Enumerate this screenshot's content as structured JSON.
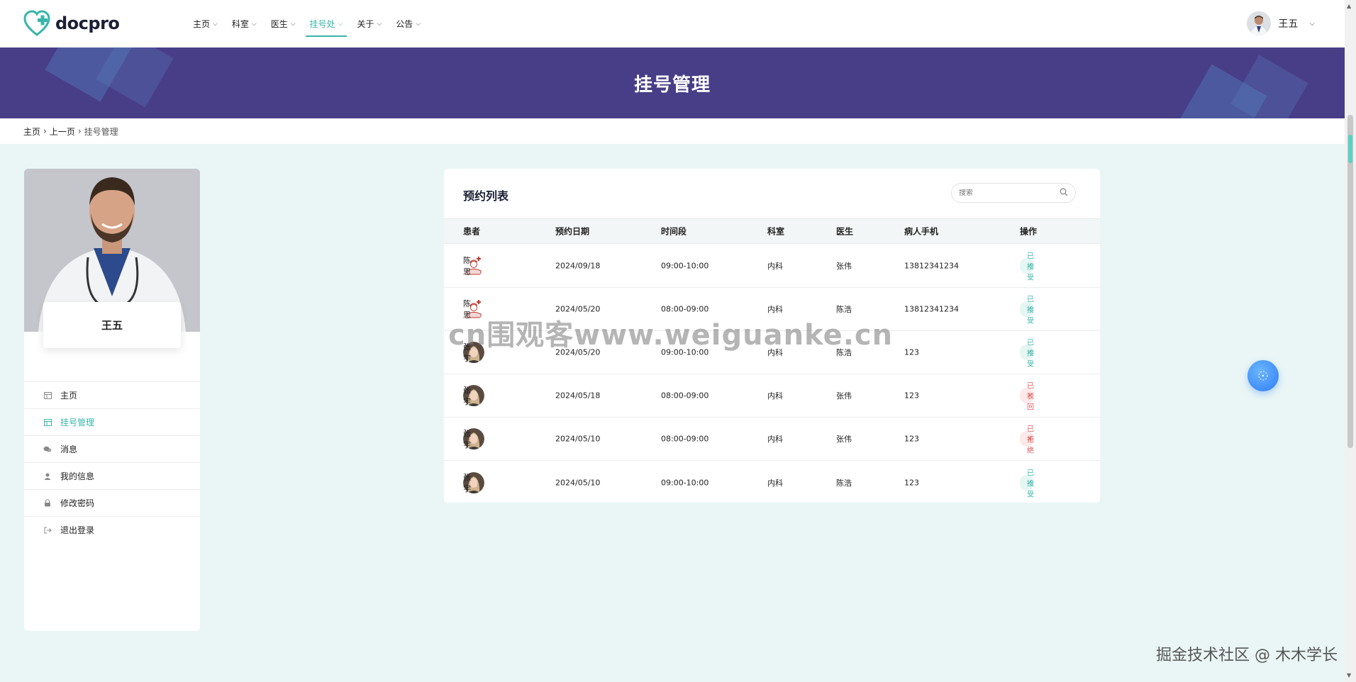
{
  "brand": {
    "name": "docpro",
    "accent": "#3ab5a9",
    "banner_color": "#483e87"
  },
  "nav": {
    "items": [
      {
        "label": "主页",
        "active": false
      },
      {
        "label": "科室",
        "active": false
      },
      {
        "label": "医生",
        "active": false
      },
      {
        "label": "挂号处",
        "active": true
      },
      {
        "label": "关于",
        "active": false
      },
      {
        "label": "公告",
        "active": false
      }
    ]
  },
  "user": {
    "name": "王五"
  },
  "banner": {
    "title": "挂号管理"
  },
  "breadcrumb": {
    "home": "主页",
    "prev": "上一页",
    "current": "挂号管理"
  },
  "sidebar": {
    "profile_name": "王五",
    "menu": [
      {
        "label": "主页",
        "icon": "layout-icon",
        "active": false
      },
      {
        "label": "挂号管理",
        "icon": "layout-icon",
        "active": true
      },
      {
        "label": "消息",
        "icon": "chat-icon",
        "active": false
      },
      {
        "label": "我的信息",
        "icon": "user-icon",
        "active": false
      },
      {
        "label": "修改密码",
        "icon": "lock-icon",
        "active": false
      },
      {
        "label": "退出登录",
        "icon": "logout-icon",
        "active": false
      }
    ]
  },
  "appointments": {
    "title": "预约列表",
    "search_placeholder": "搜索",
    "columns": [
      "患者",
      "预约日期",
      "时间段",
      "科室",
      "医生",
      "病人手机",
      "操作"
    ],
    "rows": [
      {
        "patient": "陈思",
        "avatar": "nurse",
        "date": "2024/09/18",
        "slot": "09:00-10:00",
        "dept": "内科",
        "doctor": "张伟",
        "phone": "13812341234",
        "status": "已接受",
        "status_type": "ok"
      },
      {
        "patient": "陈思",
        "avatar": "nurse",
        "date": "2024/05/20",
        "slot": "08:00-09:00",
        "dept": "内科",
        "doctor": "陈浩",
        "phone": "13812341234",
        "status": "已接受",
        "status_type": "ok"
      },
      {
        "patient": "张宇",
        "avatar": "woman",
        "date": "2024/05/20",
        "slot": "09:00-10:00",
        "dept": "内科",
        "doctor": "陈浩",
        "phone": "123",
        "status": "已接受",
        "status_type": "ok"
      },
      {
        "patient": "张宇",
        "avatar": "woman",
        "date": "2024/05/18",
        "slot": "08:00-09:00",
        "dept": "内科",
        "doctor": "张伟",
        "phone": "123",
        "status": "已驳回",
        "status_type": "no"
      },
      {
        "patient": "张宇",
        "avatar": "woman",
        "date": "2024/05/10",
        "slot": "08:00-09:00",
        "dept": "内科",
        "doctor": "张伟",
        "phone": "123",
        "status": "已拒绝",
        "status_type": "no"
      },
      {
        "patient": "张宇",
        "avatar": "woman",
        "date": "2024/05/10",
        "slot": "09:00-10:00",
        "dept": "内科",
        "doctor": "陈浩",
        "phone": "123",
        "status": "已接受",
        "status_type": "ok"
      }
    ]
  },
  "overlay": {
    "watermark": "cn围观客www.weiguanke.cn",
    "credit": "掘金技术社区 @ 木木学长"
  }
}
